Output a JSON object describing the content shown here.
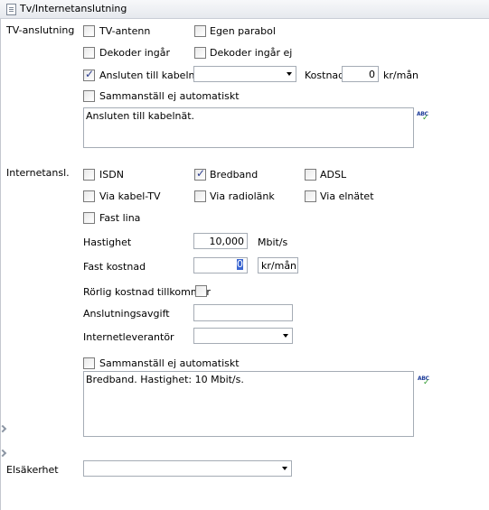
{
  "window": {
    "title": "Tv/Internetanslutning"
  },
  "tv": {
    "section_label": "TV-anslutning",
    "tv_antenn": "TV-antenn",
    "egen_parabol": "Egen parabol",
    "dekoder_ingar": "Dekoder ingår",
    "dekoder_ingar_ej": "Dekoder ingår ej",
    "ansluten_kabelnat": "Ansluten till kabelnät",
    "kabelnat_select": "",
    "kostnad_label": "Kostnad",
    "kostnad_value": "0",
    "kostnad_unit": "kr/mån",
    "sammanstall_ej": "Sammanställ ej automatiskt",
    "summary_text": "Ansluten till kabelnät."
  },
  "internet": {
    "section_label": "Internetansl.",
    "isdn": "ISDN",
    "bredband": "Bredband",
    "adsl": "ADSL",
    "via_kabel_tv": "Via kabel-TV",
    "via_radiolank": "Via radiolänk",
    "via_elnatet": "Via elnätet",
    "fast_lina": "Fast lina",
    "hastighet_label": "Hastighet",
    "hastighet_value": "10,000",
    "hastighet_unit": "Mbit/s",
    "fast_kostnad_label": "Fast kostnad",
    "fast_kostnad_value": "0",
    "fast_kostnad_unit": "kr/mån",
    "rorlig_label": "Rörlig kostnad tillkommer",
    "anslutningsavgift_label": "Anslutningsavgift",
    "anslutningsavgift_value": "",
    "leverantor_label": "Internetleverantör",
    "leverantor_value": "",
    "sammanstall_ej": "Sammanställ ej automatiskt",
    "summary_text": "Bredband. Hastighet: 10 Mbit/s."
  },
  "elsakerhet": {
    "label": "Elsäkerhet",
    "value": ""
  },
  "state": {
    "tv_antenn": false,
    "egen_parabol": false,
    "dekoder_ingar": false,
    "dekoder_ingar_ej": false,
    "ansluten_kabelnat": true,
    "tv_sammanstall_ej": false,
    "isdn": false,
    "bredband": true,
    "adsl": false,
    "via_kabel_tv": false,
    "via_radiolank": false,
    "via_elnatet": false,
    "fast_lina": false,
    "rorlig": false,
    "inet_sammanstall_ej": false
  },
  "icons": {
    "document": "document-icon",
    "spellcheck": "spellcheck-icon",
    "dropdown": "chevron-down-icon"
  },
  "colors": {
    "border": "#a5acb5",
    "check": "#2d3e8e",
    "selection": "#3b66d1",
    "spell_check": "#2e9a2e"
  }
}
